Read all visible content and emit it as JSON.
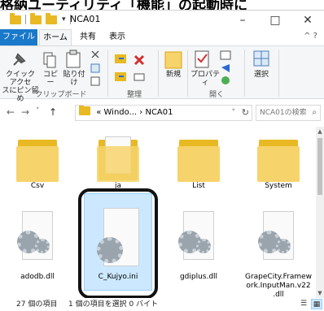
{
  "caption": "格納ユーティリティ「機能」の起動時に",
  "window": {
    "title": "NCA01",
    "minimize": "–",
    "maximize": "□",
    "close": "✕"
  },
  "ribbon_tabs": {
    "file": "ファイル",
    "home": "ホーム",
    "share": "共有",
    "view": "表示",
    "help": "^ ?"
  },
  "ribbon": {
    "quick_access": "クイック アクセ\nスにピン留め",
    "copy": "コピー",
    "paste": "貼り付け",
    "clipboard_group": "クリップボード",
    "organize_group": "整理",
    "new": "新規",
    "properties": "プロパティ",
    "open_group": "開く",
    "select": "選択"
  },
  "nav": {
    "back": "←",
    "forward": "→",
    "history": "˅",
    "up": "↑",
    "address_prefix": "«",
    "address_path": "Windo... › NCA01",
    "address_chevron": "˅",
    "refresh": "↻",
    "search_placeholder": "NCA01の検索",
    "search_icon": "⌕"
  },
  "items": [
    {
      "label": "Csv",
      "type": "folder"
    },
    {
      "label": "ja",
      "type": "folder-pages"
    },
    {
      "label": "List",
      "type": "folder"
    },
    {
      "label": "System",
      "type": "folder"
    },
    {
      "label": "adodb.dll",
      "type": "dll"
    },
    {
      "label": "C_Kujyo.ini",
      "type": "ini",
      "selected": true
    },
    {
      "label": "gdiplus.dll",
      "type": "dll"
    },
    {
      "label": "GrapeCity.Framew\nork.InputMan.v22\n.dll",
      "type": "dll"
    }
  ],
  "status": {
    "count": "27 個の項目",
    "selection": "1 個の項目を選択 0 バイト"
  },
  "icons": {
    "pin": "pin-icon",
    "copy": "copy-icon",
    "paste": "paste-icon",
    "delete": "delete-icon",
    "new_folder": "new-folder-icon",
    "properties": "properties-icon",
    "select": "select-icon"
  },
  "colors": {
    "file_tab": "#1979ca",
    "selection_bg": "#cce8ff",
    "folder": "#e8b923"
  }
}
